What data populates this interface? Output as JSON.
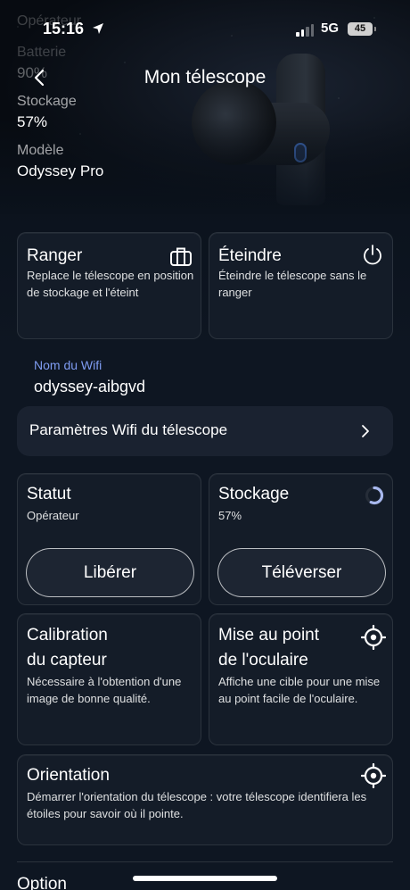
{
  "status_bar": {
    "time": "15:16",
    "network": "5G",
    "battery": "45"
  },
  "header": {
    "title": "Mon télescope"
  },
  "info": {
    "top_label": "Opérateur",
    "battery_label": "Batterie",
    "battery_value": "90%",
    "storage_label": "Stockage",
    "storage_value": "57%",
    "model_label": "Modèle",
    "model_value": "Odyssey Pro"
  },
  "actions": {
    "park": {
      "title": "Ranger",
      "description": "Replace le télescope en position de stockage et l'éteint",
      "icon": "suitcase-icon"
    },
    "shutdown": {
      "title": "Éteindre",
      "description": "Éteindre le télescope sans le ranger",
      "icon": "power-icon"
    }
  },
  "wifi": {
    "label": "Nom du Wifi",
    "value": "odyssey-aibgvd",
    "settings_label": "Paramètres Wifi du télescope"
  },
  "status_card": {
    "title": "Statut",
    "value": "Opérateur",
    "button": "Libérer"
  },
  "storage_card": {
    "title": "Stockage",
    "value": "57%",
    "button": "Téléverser",
    "fraction_used": 0.57
  },
  "calibration": {
    "title_line1": "Calibration",
    "title_line2": "du capteur",
    "description": "Nécessaire à l'obtention d'une image de bonne qualité."
  },
  "focus": {
    "title_line1": "Mise au point",
    "title_line2": "de l'oculaire",
    "description": "Affiche une cible pour une mise au point facile de l'oculaire.",
    "icon": "crosshair-icon"
  },
  "orientation": {
    "title": "Orientation",
    "description": "Démarrer l'orientation du télescope : votre télescope identifiera les étoiles pour savoir où il pointe.",
    "icon": "crosshair-icon"
  },
  "footer": {
    "option_label": "Option"
  },
  "colors": {
    "accent": "#7f9cf2",
    "background": "#0e1622",
    "card": "#141c28"
  }
}
